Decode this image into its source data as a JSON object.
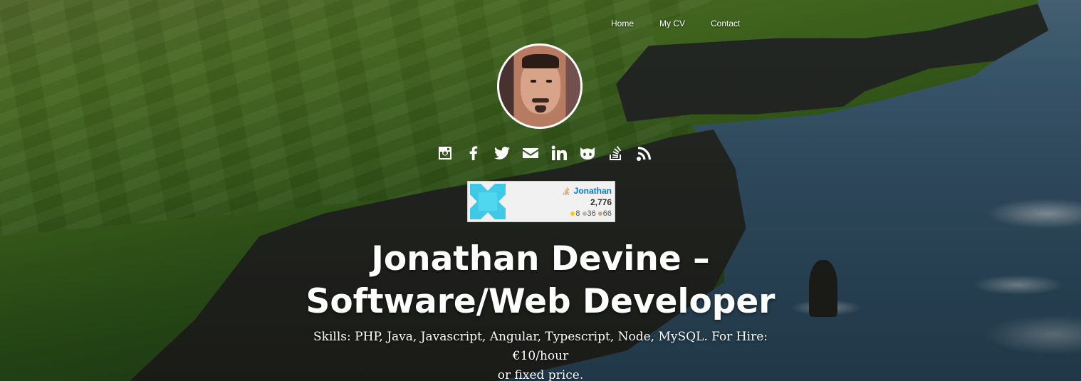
{
  "nav": {
    "items": [
      {
        "label": "Home"
      },
      {
        "label": "My CV"
      },
      {
        "label": "Contact"
      }
    ]
  },
  "social": {
    "icons": [
      "instagram-icon",
      "facebook-icon",
      "twitter-icon",
      "email-icon",
      "linkedin-icon",
      "github-icon",
      "stackoverflow-icon",
      "rss-icon"
    ]
  },
  "flair": {
    "name": "Jonathan",
    "reputation": "2,776",
    "badges": {
      "gold": "8",
      "silver": "36",
      "bronze": "66"
    },
    "colors": {
      "name": "#0077cc",
      "gold": "#ffcc00",
      "silver": "#b4b8bc",
      "bronze": "#d1a684"
    }
  },
  "hero": {
    "title_line1": "Jonathan Devine –",
    "title_line2": "Software/Web Developer",
    "subtitle_line1": "Skills: PHP, Java, Javascript, Angular, Typescript, Node, MySQL. For Hire: €10/hour",
    "subtitle_line2": "or fixed price."
  }
}
